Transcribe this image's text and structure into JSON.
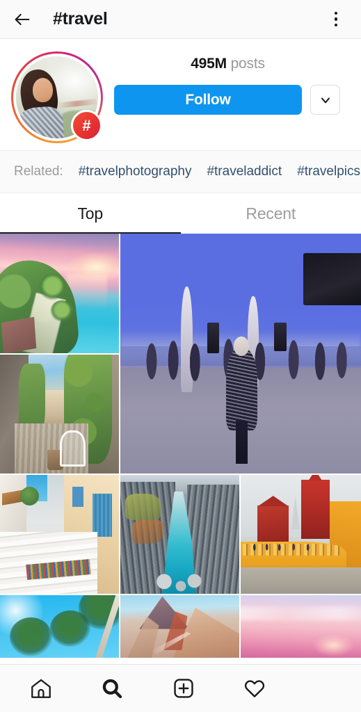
{
  "appbar": {
    "back_icon": "arrow-left-icon",
    "title": "#travel",
    "menu_icon": "more-vertical-icon"
  },
  "hero": {
    "avatar_icon": "hashtag-avatar",
    "badge_label": "#",
    "posts_count": "495M",
    "posts_label": "posts",
    "follow_label": "Follow",
    "chevron_icon": "chevron-down-icon"
  },
  "related": {
    "label": "Related:",
    "tags": [
      "#travelphotography",
      "#traveladdict",
      "#travelpics",
      "#"
    ]
  },
  "tabs": [
    {
      "label": "Top",
      "active": true
    },
    {
      "label": "Recent",
      "active": false
    }
  ],
  "grid": {
    "rows": [
      {
        "type": "feature",
        "cells": [
          {
            "name": "post-tropical-beach-sunset"
          },
          {
            "name": "post-ivy-alley-chair"
          },
          {
            "name": "post-twilight-harbour-crowd"
          }
        ]
      },
      {
        "type": "trio",
        "cells": [
          {
            "name": "post-greek-stairs"
          },
          {
            "name": "post-basalt-canyon-river"
          },
          {
            "name": "post-pena-palace"
          }
        ]
      },
      {
        "type": "partial",
        "cells": [
          {
            "name": "post-palm-trees"
          },
          {
            "name": "post-rainbow-mountain"
          },
          {
            "name": "post-pink-sunset"
          }
        ]
      }
    ]
  },
  "bottomnav": {
    "items": [
      {
        "icon": "home-icon",
        "active": false
      },
      {
        "icon": "search-icon",
        "active": true
      },
      {
        "icon": "add-post-icon",
        "active": false
      },
      {
        "icon": "heart-icon",
        "active": false
      },
      {
        "icon": "profile-icon",
        "active": false
      }
    ]
  },
  "colors": {
    "follow_blue": "#0E95F0",
    "appbar_bg": "#FAFAFA",
    "text_dark": "#18191A",
    "text_muted": "#9A9A9A",
    "tag_blue": "#32506E",
    "badge_red": "#E8332F"
  }
}
